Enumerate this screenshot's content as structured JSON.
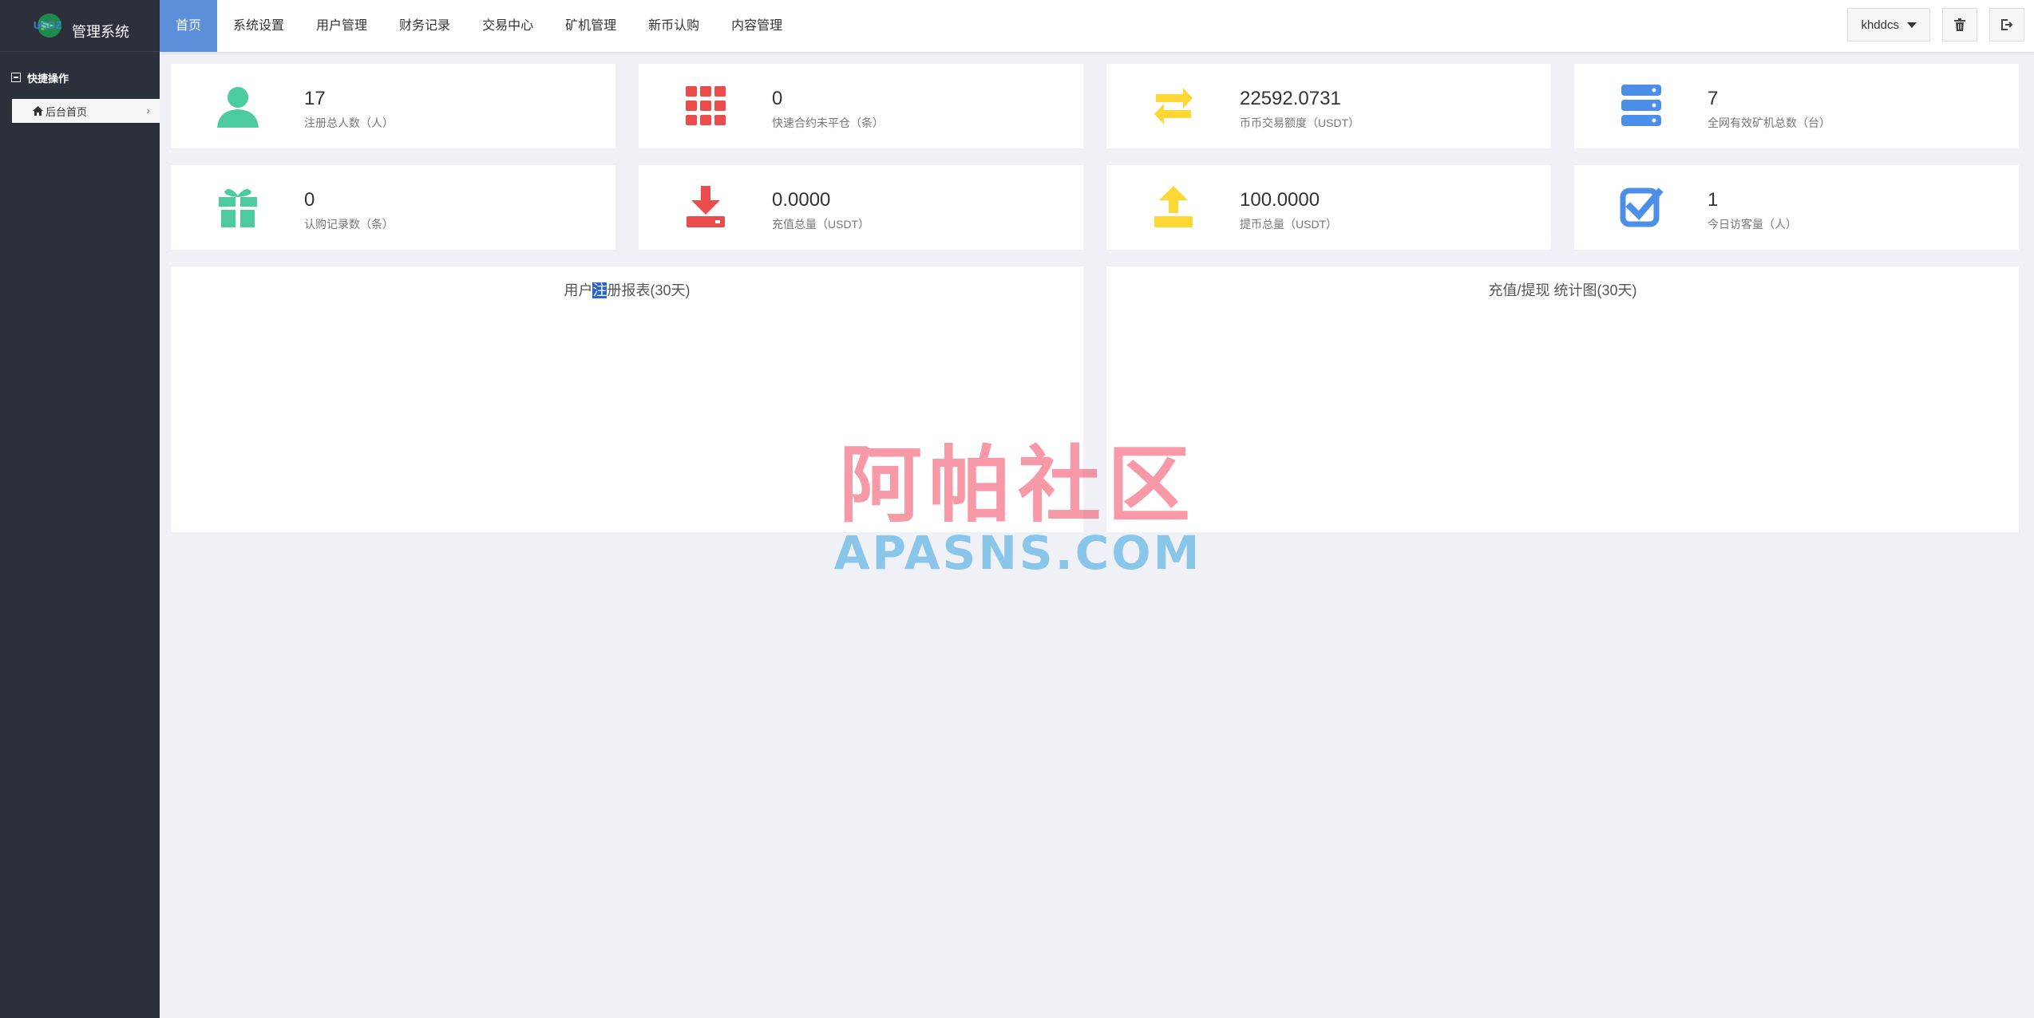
{
  "app": {
    "logo_text": "USDZ",
    "title": "管理系统"
  },
  "sidebar": {
    "section_title": "快捷操作",
    "items": [
      {
        "label": "后台首页",
        "icon": "home-icon"
      }
    ]
  },
  "nav": {
    "items": [
      {
        "label": "首页",
        "active": true
      },
      {
        "label": "系统设置"
      },
      {
        "label": "用户管理"
      },
      {
        "label": "财务记录"
      },
      {
        "label": "交易中心"
      },
      {
        "label": "矿机管理"
      },
      {
        "label": "新币认购"
      },
      {
        "label": "内容管理"
      }
    ]
  },
  "header": {
    "username": "khddcs",
    "clear_cache_icon": "trash-icon",
    "logout_icon": "logout-icon"
  },
  "stats": [
    {
      "value": "17",
      "label": "注册总人数（人）",
      "icon": "user-icon",
      "color": "#4ccb9d"
    },
    {
      "value": "0",
      "label": "快速合约未平仓（条）",
      "icon": "grid-icon",
      "color": "#ea4b4b"
    },
    {
      "value": "22592.0731",
      "label": "币币交易额度（USDT）",
      "icon": "exchange-icon",
      "color": "#fdd835"
    },
    {
      "value": "7",
      "label": "全网有效矿机总数（台）",
      "icon": "server-icon",
      "color": "#4b8fe8"
    },
    {
      "value": "0",
      "label": "认购记录数（条）",
      "icon": "gift-icon",
      "color": "#4ccb9d"
    },
    {
      "value": "0.0000",
      "label": "充值总量（USDT）",
      "icon": "download-icon",
      "color": "#ea4b4b"
    },
    {
      "value": "100.0000",
      "label": "提币总量（USDT）",
      "icon": "upload-icon",
      "color": "#fdd835"
    },
    {
      "value": "1",
      "label": "今日访客量（人）",
      "icon": "check-square-icon",
      "color": "#4b8fe8"
    }
  ],
  "charts": {
    "left_title_pre": "用户",
    "left_title_hl": "注",
    "left_title_post": "册报表(30天)",
    "right_title": "充值/提现 统计图(30天)"
  },
  "watermark": {
    "cn": "阿帕社区",
    "en": "APASNS.COM"
  }
}
